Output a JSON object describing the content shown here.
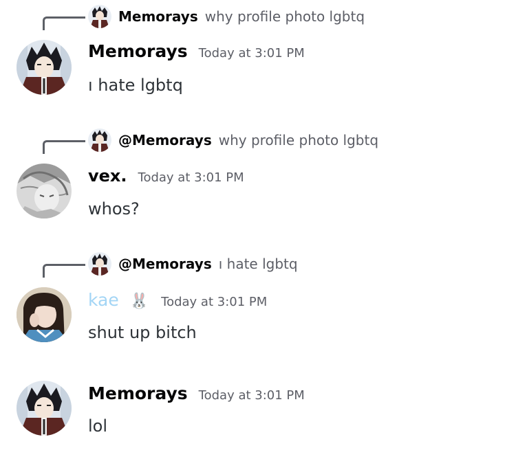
{
  "messages": [
    {
      "reply": {
        "author": "Memorays",
        "text": "why profile photo lgbtq"
      },
      "author": "Memorays",
      "timestamp": "Today at 3:01 PM",
      "content": "ı hate lgbtq"
    },
    {
      "reply": {
        "author": "@Memorays",
        "text": "why profile photo lgbtq"
      },
      "author": "vex.",
      "timestamp": "Today at 3:01 PM",
      "content": "whos?"
    },
    {
      "reply": {
        "author": "@Memorays",
        "text": "ı hate lgbtq"
      },
      "author": "kae",
      "author_emoji": "🐰",
      "author_color": "#a3d5f5",
      "timestamp": "Today at 3:01 PM",
      "content": "shut up bitch"
    },
    {
      "author": "Memorays",
      "timestamp": "Today at 3:01 PM",
      "content": "lol"
    }
  ]
}
